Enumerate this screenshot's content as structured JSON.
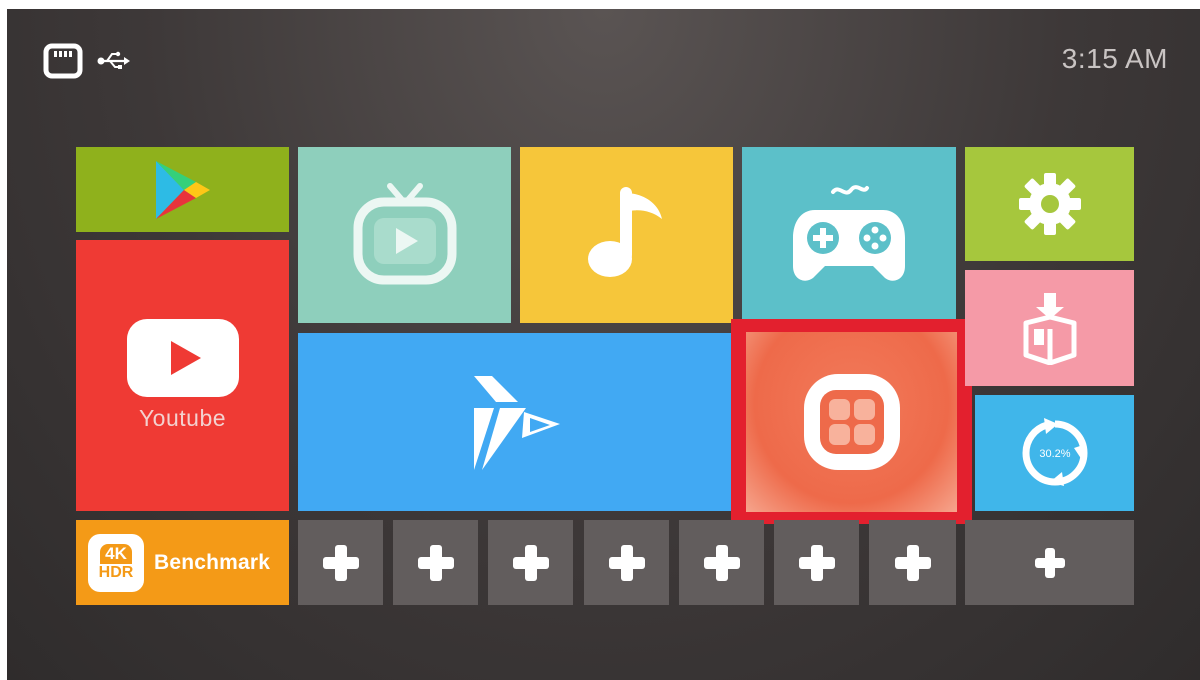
{
  "status_bar": {
    "time": "3:15 AM",
    "icons": [
      "sd-card-icon",
      "usb-icon"
    ]
  },
  "tiles": {
    "play_store": {
      "icon": "play-store-icon",
      "color": "#8fb11c"
    },
    "youtube": {
      "label": "Youtube",
      "icon": "youtube-icon",
      "color": "#ef3a34"
    },
    "live_tv": {
      "icon": "tv-icon",
      "color": "#8ecfbc"
    },
    "music": {
      "icon": "music-note-icon",
      "color": "#f6c63a"
    },
    "games": {
      "icon": "gamepad-icon",
      "color": "#5cc0c9"
    },
    "settings": {
      "icon": "gear-icon",
      "color": "#a6c73d"
    },
    "video_player": {
      "icon": "video-player-icon",
      "color": "#41a9f3"
    },
    "all_apps": {
      "icon": "apps-grid-icon",
      "color": "#ee6a4a",
      "selected": true,
      "focus_color": "#e3202e"
    },
    "app_installer": {
      "icon": "install-box-icon",
      "color": "#f59aa7"
    },
    "cleaner": {
      "icon": "cleaner-icon",
      "percent": "30.2%",
      "color": "#40b6ea"
    },
    "benchmark": {
      "label": "Benchmark",
      "badge_top": "4K",
      "badge_bottom": "HDR",
      "color": "#f49a17"
    }
  },
  "add_slots": [
    {
      "icon": "plus-icon"
    },
    {
      "icon": "plus-icon"
    },
    {
      "icon": "plus-icon"
    },
    {
      "icon": "plus-icon"
    },
    {
      "icon": "plus-icon"
    },
    {
      "icon": "plus-icon"
    },
    {
      "icon": "plus-icon"
    },
    {
      "icon": "plus-icon"
    }
  ]
}
